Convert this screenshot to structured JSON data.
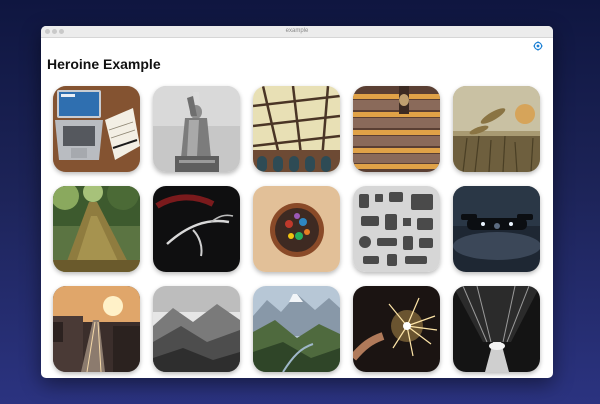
{
  "window": {
    "title": "example"
  },
  "page": {
    "title": "Heroine Example"
  },
  "toolbar": {
    "settings_icon": "gear-icon",
    "accent_color": "#1a7fd4"
  },
  "photos": [
    {
      "name": "photo-laptop-desk"
    },
    {
      "name": "photo-statue-of-liberty"
    },
    {
      "name": "photo-glass-building"
    },
    {
      "name": "photo-stairs"
    },
    {
      "name": "photo-wheat-field"
    },
    {
      "name": "photo-mossy-stump"
    },
    {
      "name": "photo-dark-antlers"
    },
    {
      "name": "photo-bowl-food"
    },
    {
      "name": "photo-gadgets-flatlay"
    },
    {
      "name": "photo-drone"
    },
    {
      "name": "photo-sunset-railway"
    },
    {
      "name": "photo-bw-valley"
    },
    {
      "name": "photo-mountains"
    },
    {
      "name": "photo-sparkler"
    },
    {
      "name": "photo-bw-tree-tunnel"
    }
  ]
}
